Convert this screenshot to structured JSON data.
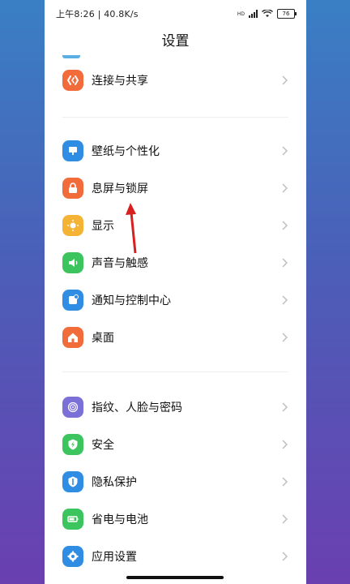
{
  "status_bar": {
    "time_speed": "上午8:26 | 40.8K/s",
    "network": "HD",
    "battery": "76"
  },
  "header": {
    "title": "设置"
  },
  "group1": [
    {
      "label": "连接与共享",
      "icon": "share-icon",
      "color": "#f26b3a"
    }
  ],
  "group2": [
    {
      "label": "壁纸与个性化",
      "icon": "wallpaper-icon",
      "color": "#2f8de4"
    },
    {
      "label": "息屏与锁屏",
      "icon": "lock-icon",
      "color": "#f26b3a"
    },
    {
      "label": "显示",
      "icon": "sun-icon",
      "color": "#f5b335"
    },
    {
      "label": "声音与触感",
      "icon": "speaker-icon",
      "color": "#3cc45f"
    },
    {
      "label": "通知与控制中心",
      "icon": "notification-icon",
      "color": "#2f8de4"
    },
    {
      "label": "桌面",
      "icon": "home-icon",
      "color": "#f26b3a"
    }
  ],
  "group3": [
    {
      "label": "指纹、人脸与密码",
      "icon": "fingerprint-icon",
      "color": "#7b6fd8"
    },
    {
      "label": "安全",
      "icon": "shield-icon",
      "color": "#3cc45f"
    },
    {
      "label": "隐私保护",
      "icon": "privacy-icon",
      "color": "#2f8de4"
    },
    {
      "label": "省电与电池",
      "icon": "battery-icon",
      "color": "#3cc45f"
    },
    {
      "label": "应用设置",
      "icon": "gear-icon",
      "color": "#2f8de4"
    }
  ],
  "annotation": {
    "arrow_color": "#d92020"
  }
}
